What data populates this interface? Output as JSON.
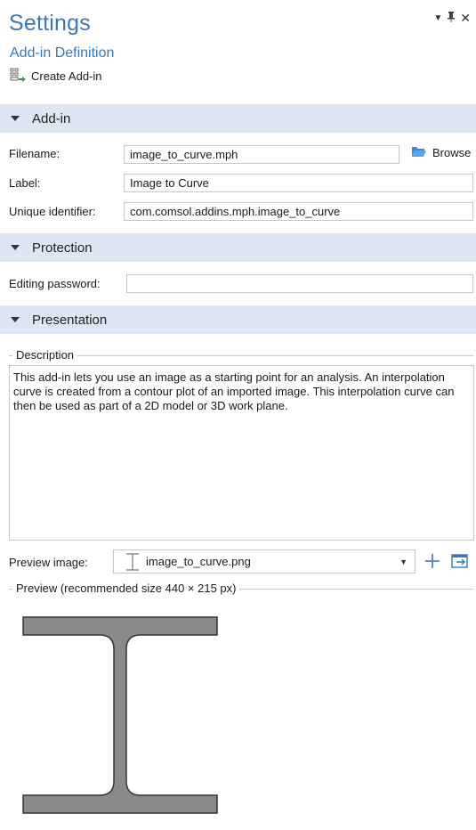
{
  "header": {
    "title": "Settings",
    "subtitle": "Add-in Definition",
    "create_label": "Create Add-in"
  },
  "sections": {
    "addin": "Add-in",
    "protection": "Protection",
    "presentation": "Presentation"
  },
  "addin": {
    "filename_label": "Filename:",
    "filename_value": "image_to_curve.mph",
    "browse_label": "Browse",
    "label_label": "Label:",
    "label_value": "Image to Curve",
    "uid_label": "Unique identifier:",
    "uid_value": "com.comsol.addins.mph.image_to_curve"
  },
  "protection": {
    "password_label": "Editing password:",
    "password_value": ""
  },
  "presentation": {
    "description_group": "Description",
    "description_text": "This add-in lets you use an image as a starting point for an analysis. An interpolation curve is created from a contour plot of an imported image. This interpolation curve can then be used as part of a 2D model or 3D work plane.",
    "preview_image_label": "Preview image:",
    "preview_image_value": "image_to_curve.png",
    "preview_group": "Preview (recommended size 440 × 215 px)"
  },
  "icons": {
    "header": [
      "dropdown-arrow-icon",
      "pin-icon",
      "close-icon"
    ],
    "create": "create-addin-icon",
    "browse": "folder-open-icon",
    "preview_add": "plus-icon",
    "preview_import": "import-icon"
  },
  "colors": {
    "title": "#3a78b8",
    "section_bg": "#dde7f4",
    "preview_shape": "#8a8a8a"
  }
}
